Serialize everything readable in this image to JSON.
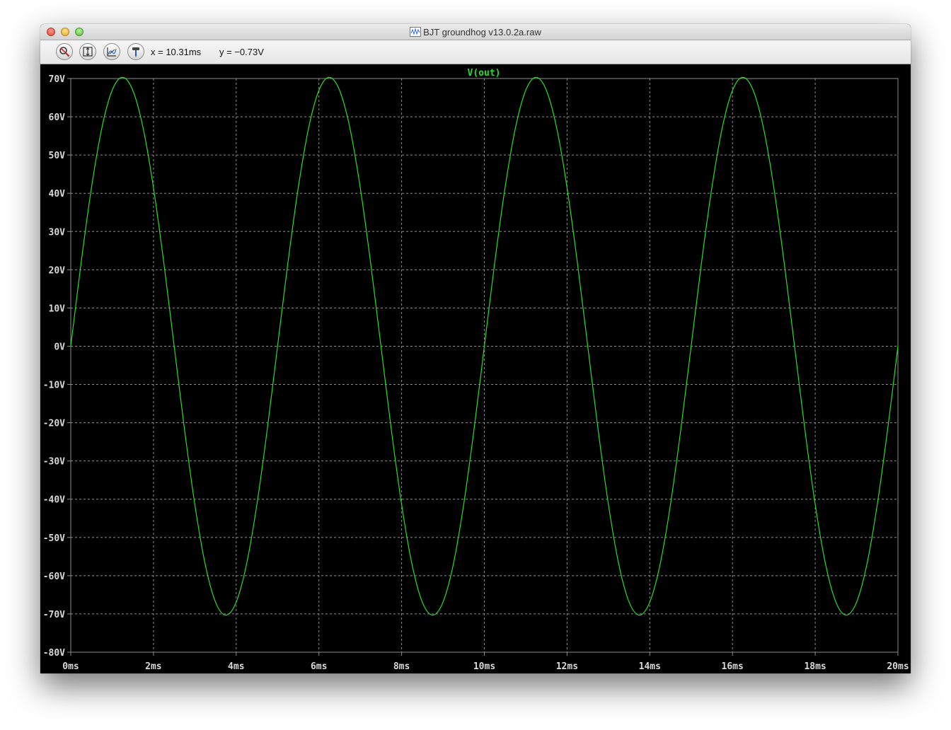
{
  "window": {
    "title": "BJT groundhog v13.0.2a.raw"
  },
  "toolbar": {
    "buttons": [
      {
        "icon": "zoom-out-icon",
        "label": "zoom-out"
      },
      {
        "icon": "zoom-fit-icon",
        "label": "zoom-fit"
      },
      {
        "icon": "autorange-icon",
        "label": "autorange"
      },
      {
        "icon": "probe-icon",
        "label": "probe"
      }
    ],
    "cursor_x": "x = 10.31ms",
    "cursor_y": "y = −0.73V"
  },
  "colors": {
    "background": "#000000",
    "grid": "#8c8c8c",
    "trace": "#22e022",
    "tick_text": "#d8d8d8"
  },
  "chart_data": {
    "type": "line",
    "title": "V(out)",
    "xlabel": "",
    "ylabel": "",
    "xlim": [
      0,
      20
    ],
    "ylim": [
      -80,
      70
    ],
    "x_unit": "ms",
    "y_unit": "V",
    "grid": true,
    "x_ticks": [
      "0ms",
      "2ms",
      "4ms",
      "6ms",
      "8ms",
      "10ms",
      "12ms",
      "14ms",
      "16ms",
      "18ms",
      "20ms"
    ],
    "y_ticks": [
      "70V",
      "60V",
      "50V",
      "40V",
      "30V",
      "20V",
      "10V",
      "0V",
      "-10V",
      "-20V",
      "-30V",
      "-40V",
      "-50V",
      "-60V",
      "-70V",
      "-80V"
    ],
    "series": [
      {
        "name": "V(out)",
        "x": [
          0,
          0.25,
          0.5,
          0.75,
          1.0,
          1.25,
          1.5,
          1.75,
          2.0,
          2.25,
          2.5,
          2.75,
          3.0,
          3.25,
          3.5,
          3.75,
          4.0,
          4.25,
          4.5,
          4.75,
          5.0,
          5.25,
          5.5,
          5.75,
          6.0,
          6.25,
          6.5,
          6.75,
          7.0,
          7.25,
          7.5,
          7.75,
          8.0,
          8.25,
          8.5,
          8.75,
          9.0,
          9.25,
          9.5,
          9.75,
          10.0,
          10.25,
          10.5,
          10.75,
          11.0,
          11.25,
          11.5,
          11.75,
          12.0,
          12.25,
          12.5,
          12.75,
          13.0,
          13.25,
          13.5,
          13.75,
          14.0,
          14.25,
          14.5,
          14.75,
          15.0,
          15.25,
          15.5,
          15.75,
          16.0,
          16.25,
          16.5,
          16.75,
          17.0,
          17.25,
          17.5,
          17.75,
          18.0,
          18.25,
          18.5,
          18.75,
          19.0,
          19.25,
          19.5,
          19.75,
          20.0
        ],
        "values": [
          0,
          21.8,
          41.4,
          57.0,
          66.9,
          70.3,
          66.9,
          57.0,
          41.4,
          21.8,
          0,
          -21.8,
          -41.4,
          -57.0,
          -66.9,
          -70.3,
          -66.9,
          -57.0,
          -41.4,
          -21.8,
          0,
          21.8,
          41.4,
          57.0,
          66.9,
          70.3,
          66.9,
          57.0,
          41.4,
          21.8,
          0,
          -21.8,
          -41.4,
          -57.0,
          -66.9,
          -70.3,
          -66.9,
          -57.0,
          -41.4,
          -21.8,
          0,
          21.8,
          41.4,
          57.0,
          66.9,
          70.3,
          66.9,
          57.0,
          41.4,
          21.8,
          0,
          -21.8,
          -41.4,
          -57.0,
          -66.9,
          -70.3,
          -66.9,
          -57.0,
          -41.4,
          -21.8,
          0,
          21.8,
          41.4,
          57.0,
          66.9,
          70.3,
          66.9,
          57.0,
          41.4,
          21.8,
          0,
          -21.8,
          -41.4,
          -57.0,
          -66.9,
          -70.3,
          -66.9,
          -57.0,
          -41.4,
          -21.8,
          0
        ]
      }
    ]
  }
}
